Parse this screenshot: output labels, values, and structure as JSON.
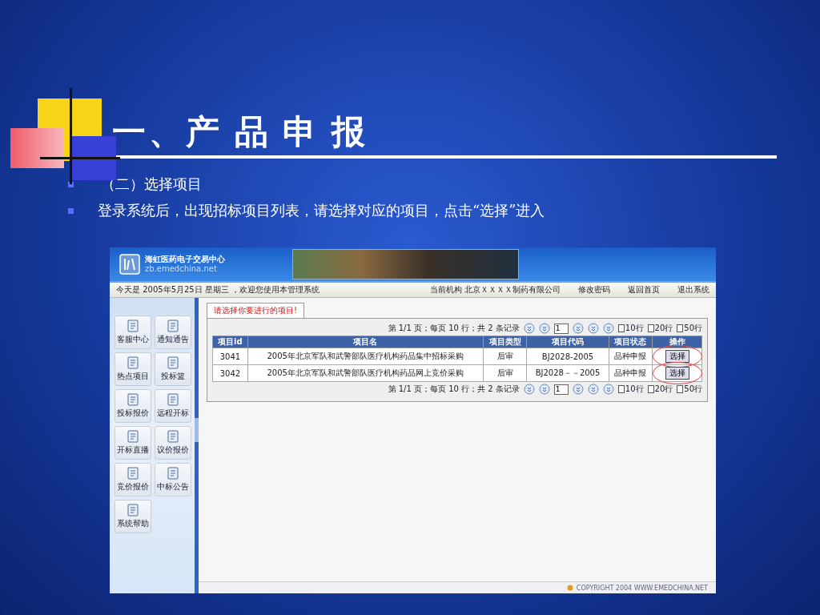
{
  "slide": {
    "title": "一、产 品 申 报",
    "bullets": [
      "（二）选择项目",
      "登录系统后，出现招标项目列表，请选择对应的项目，点击“选择”进入"
    ]
  },
  "app": {
    "logo": {
      "name": "海虹医药电子交易中心",
      "url": "zb.emedchina.net"
    },
    "info_bar": {
      "greeting": "今天是 2005年5月25日 星期三 ，欢迎您使用本管理系统",
      "org": "当前机构 北京ＸＸＸＸ制药有限公司",
      "links": [
        "修改密码",
        "返回首页",
        "退出系统"
      ]
    },
    "sidebar": {
      "items": [
        "客服中心",
        "通知通告",
        "热点项目",
        "投标篮",
        "投标报价",
        "远程开标",
        "开标直播",
        "议价报价",
        "竞价报价",
        "中标公告",
        "系统帮助"
      ]
    },
    "tab": {
      "label": "请选择你要进行的项目!"
    },
    "pagers": [
      {
        "summary": "第 1/1 页；每页 10 行；共 2 条记录",
        "page": "1",
        "sizes": [
          "10行",
          "20行",
          "50行"
        ]
      },
      {
        "summary": "第 1/1 页；每页 10 行；共 2 条记录",
        "page": "1",
        "sizes": [
          "10行",
          "20行",
          "50行"
        ]
      }
    ],
    "table": {
      "columns": [
        "项目id",
        "项目名",
        "项目类型",
        "项目代码",
        "项目状态",
        "操作"
      ],
      "rows": [
        {
          "id": "3041",
          "name": "2005年北京军队和武警部队医疗机构药品集中招标采购",
          "type": "后审",
          "code": "BJ2028-2005",
          "status": "品种申报",
          "action": "选择",
          "circled": true
        },
        {
          "id": "3042",
          "name": "2005年北京军队和武警部队医疗机构药品网上竞价采购",
          "type": "后审",
          "code": "BJ2028－－2005",
          "status": "品种申报",
          "action": "选择",
          "circled": true
        }
      ]
    },
    "footer": "COPYRIGHT 2004 WWW.EMEDCHINA.NET"
  }
}
